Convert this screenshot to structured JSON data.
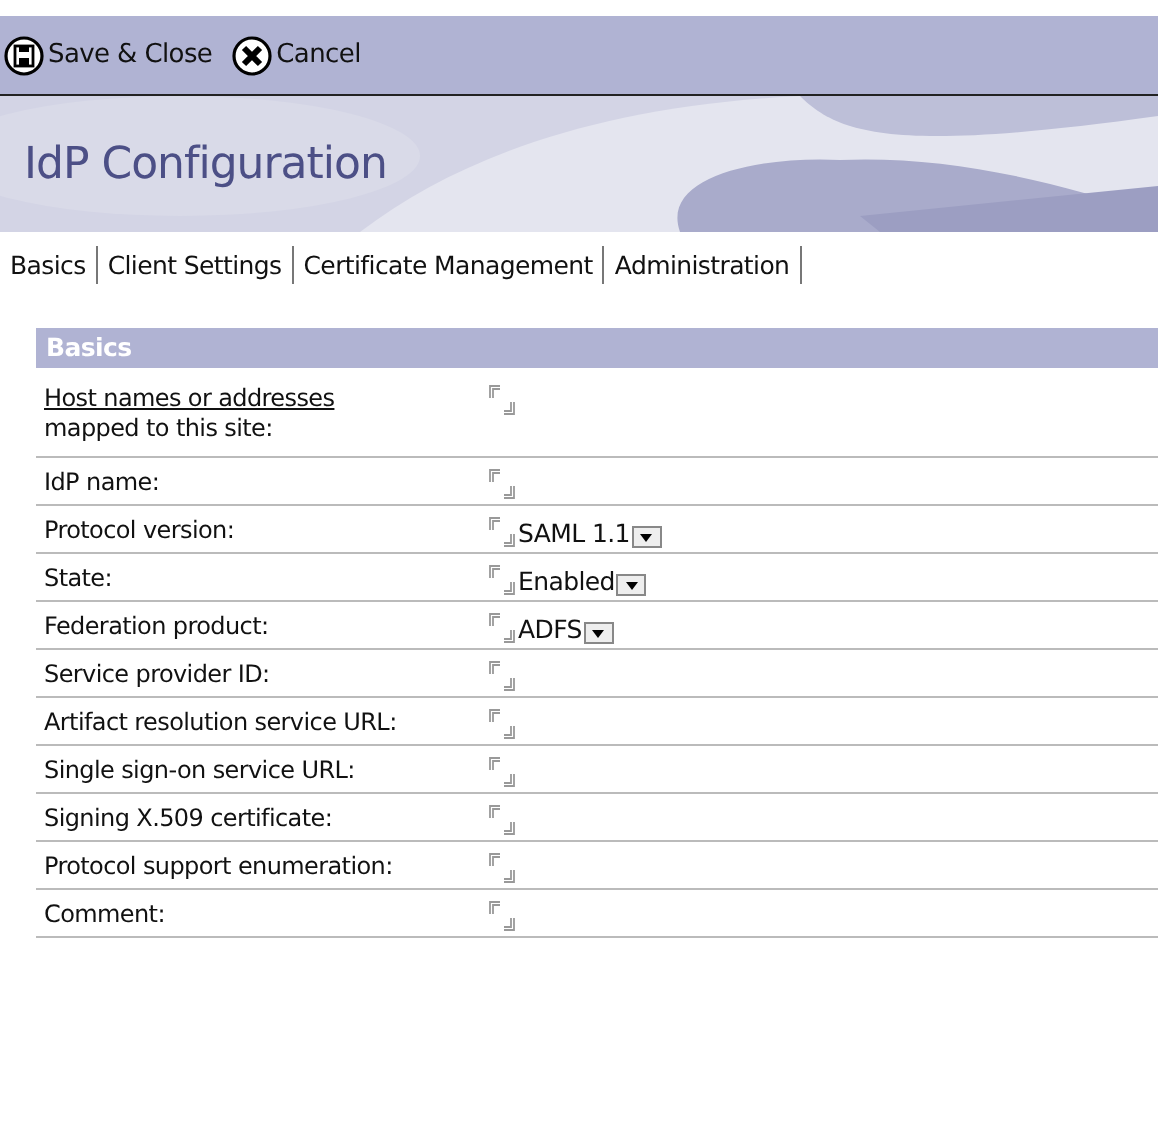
{
  "toolbar": [
    {
      "label": "Save & Close",
      "kind": "save"
    },
    {
      "label": "Cancel",
      "kind": "cancel"
    }
  ],
  "header": {
    "title": "IdP Configuration"
  },
  "tabs": [
    "Basics",
    "Client Settings",
    "Certificate Management",
    "Administration"
  ],
  "section": {
    "title": "Basics"
  },
  "fields": [
    {
      "label": "Host names or addresses",
      "label_rest": "mapped to this site:",
      "kind": "link"
    },
    {
      "label": "IdP name:",
      "kind": "text"
    },
    {
      "label": "Protocol version:",
      "kind": "select",
      "value": "SAML 1.1"
    },
    {
      "label": "State:",
      "kind": "select",
      "value": "Enabled"
    },
    {
      "label": "Federation product:",
      "kind": "select",
      "value": "ADFS"
    },
    {
      "label": "Service provider ID:",
      "kind": "text"
    },
    {
      "label": "Artifact resolution service URL:",
      "kind": "text"
    },
    {
      "label": "Single sign-on service URL:",
      "kind": "text"
    },
    {
      "label": "Signing X.509 certificate:",
      "kind": "text"
    },
    {
      "label": "Protocol support enumeration:",
      "kind": "text"
    },
    {
      "label": "Comment:",
      "kind": "text"
    }
  ]
}
